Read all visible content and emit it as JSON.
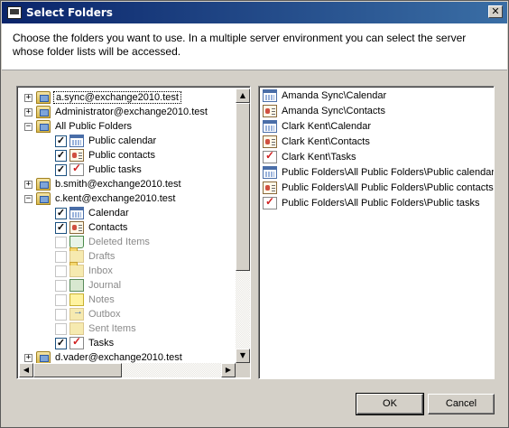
{
  "window": {
    "title": "Select Folders",
    "close_glyph": "✕"
  },
  "header": {
    "description": "Choose the folders you want to use. In a multiple server environment you can select the server whose folder lists will be accessed."
  },
  "tree": {
    "items": [
      {
        "label": "a.sync@exchange2010.test",
        "expander": "+",
        "icon": "server-icon",
        "selected": true
      },
      {
        "label": "Administrator@exchange2010.test",
        "expander": "+",
        "icon": "server-icon"
      },
      {
        "label": "All Public Folders",
        "expander": "−",
        "icon": "server-icon"
      },
      {
        "label": "Public calendar",
        "checked": "✓",
        "icon": "calendar-icon"
      },
      {
        "label": "Public contacts",
        "checked": "✓",
        "icon": "contacts-icon"
      },
      {
        "label": "Public tasks",
        "checked": "✓",
        "icon": "tasks-icon"
      },
      {
        "label": "b.smith@exchange2010.test",
        "expander": "+",
        "icon": "server-icon"
      },
      {
        "label": "c.kent@exchange2010.test",
        "expander": "−",
        "icon": "server-icon"
      },
      {
        "label": "Calendar",
        "checked": "✓",
        "icon": "calendar-icon"
      },
      {
        "label": "Contacts",
        "checked": "✓",
        "icon": "contacts-icon"
      },
      {
        "label": "Deleted Items",
        "checked": "",
        "icon": "deleted-items-icon",
        "disabled": true
      },
      {
        "label": "Drafts",
        "checked": "",
        "icon": "drafts-icon",
        "disabled": true
      },
      {
        "label": "Inbox",
        "checked": "",
        "icon": "inbox-icon",
        "disabled": true
      },
      {
        "label": "Journal",
        "checked": "",
        "icon": "journal-icon",
        "disabled": true
      },
      {
        "label": "Notes",
        "checked": "",
        "icon": "notes-icon",
        "disabled": true
      },
      {
        "label": "Outbox",
        "checked": "",
        "icon": "outbox-icon",
        "disabled": true
      },
      {
        "label": "Sent Items",
        "checked": "",
        "icon": "sent-items-icon",
        "disabled": true
      },
      {
        "label": "Tasks",
        "checked": "✓",
        "icon": "tasks-icon"
      },
      {
        "label": "d.vader@exchange2010.test",
        "expander": "+",
        "icon": "server-icon"
      }
    ]
  },
  "selected_list": {
    "items": [
      {
        "label": "Amanda Sync\\Calendar",
        "icon": "calendar-icon"
      },
      {
        "label": "Amanda Sync\\Contacts",
        "icon": "contacts-icon"
      },
      {
        "label": "Clark Kent\\Calendar",
        "icon": "calendar-icon"
      },
      {
        "label": "Clark Kent\\Contacts",
        "icon": "contacts-icon"
      },
      {
        "label": "Clark Kent\\Tasks",
        "icon": "tasks-icon"
      },
      {
        "label": "Public Folders\\All Public Folders\\Public calendar",
        "icon": "calendar-icon"
      },
      {
        "label": "Public Folders\\All Public Folders\\Public contacts",
        "icon": "contacts-icon"
      },
      {
        "label": "Public Folders\\All Public Folders\\Public tasks",
        "icon": "tasks-icon"
      }
    ]
  },
  "scrollbar": {
    "up_glyph": "▲",
    "down_glyph": "▼",
    "left_glyph": "◀",
    "right_glyph": "▶"
  },
  "buttons": {
    "ok_label": "OK",
    "cancel_label": "Cancel"
  }
}
